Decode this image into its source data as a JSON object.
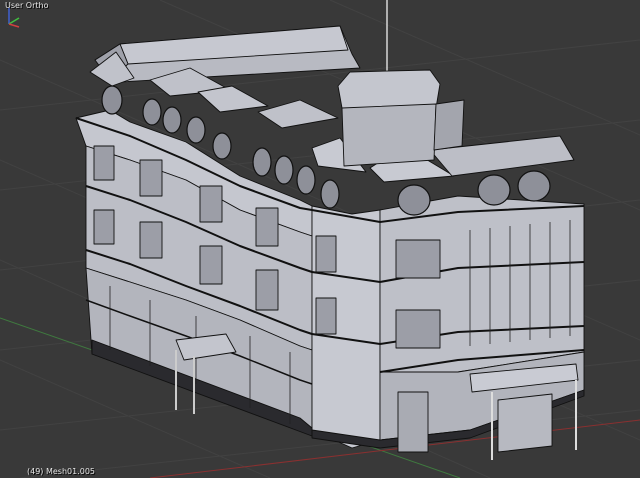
{
  "viewport": {
    "view_name": "User Ortho",
    "object_info": "(49) Mesh01.005",
    "background_color": "#393939",
    "grid_color": "#424242",
    "x_axis_color": "#8a3030",
    "y_axis_color": "#3f7a3f",
    "mesh_fill_color": "#c9cbd3",
    "mesh_wire_color": "#111111"
  },
  "gizmo": {
    "axes": [
      "x-axis-icon",
      "y-axis-icon",
      "z-axis-icon"
    ],
    "colors": {
      "x": "#d04040",
      "y": "#40c040",
      "z": "#4060d0"
    }
  }
}
